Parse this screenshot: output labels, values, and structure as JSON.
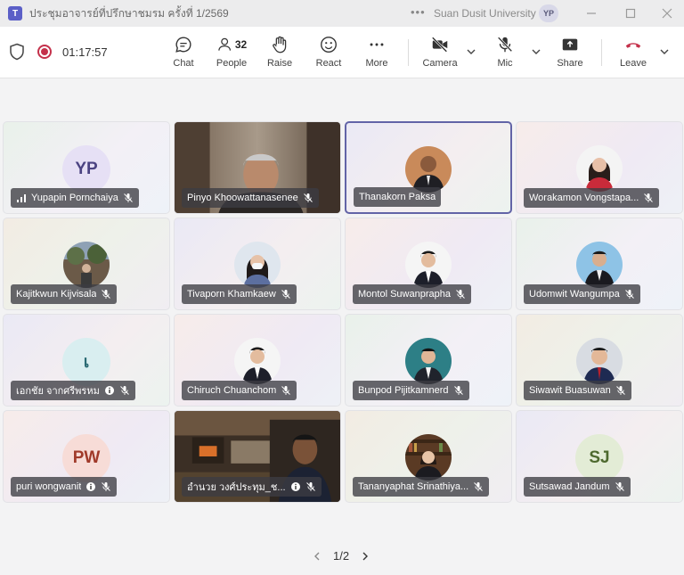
{
  "window": {
    "title": "ประชุมอาจารย์ที่ปรึกษาชมรม ครั้งที่ 1/2569",
    "organization": "Suan Dusit University",
    "user_initials": "YP",
    "app_icon_letter": "T"
  },
  "toolbar": {
    "timer": "01:17:57",
    "chat_label": "Chat",
    "people_label": "People",
    "people_count": "32",
    "raise_label": "Raise",
    "react_label": "React",
    "more_label": "More",
    "camera_label": "Camera",
    "mic_label": "Mic",
    "share_label": "Share",
    "leave_label": "Leave"
  },
  "participants": [
    {
      "name": "Yupapin Pornchaiya",
      "initials": "YP",
      "kind": "initials",
      "avatar_color": "#e6e0f5",
      "text_color": "#4b4382",
      "muted": true,
      "signal": true
    },
    {
      "name": "Pinyo Khoowattanasenee",
      "kind": "video",
      "muted": true
    },
    {
      "name": "Thanakorn Paksa",
      "kind": "photo",
      "photo_style": "suit-warm",
      "active": true,
      "muted": false
    },
    {
      "name": "Worakamon Vongstapa...",
      "kind": "photo",
      "photo_style": "woman-white",
      "muted": true
    },
    {
      "name": "Kajitkwun Kijvisala",
      "kind": "photo",
      "photo_style": "outdoor",
      "muted": true
    },
    {
      "name": "Tivaporn Khamkaew",
      "kind": "photo",
      "photo_style": "woman-mask",
      "muted": true
    },
    {
      "name": "Montol Suwanprapha",
      "kind": "photo",
      "photo_style": "suit-white",
      "muted": true
    },
    {
      "name": "Udomwit Wangumpa",
      "kind": "photo",
      "photo_style": "suit-blue",
      "muted": true
    },
    {
      "name": "เอกชัย จากศรีพรหม",
      "initials": "เ",
      "kind": "initials",
      "avatar_color": "#d9eef0",
      "text_color": "#2a6a73",
      "muted": true,
      "extra_icon": true
    },
    {
      "name": "Chiruch Chuanchom",
      "kind": "photo",
      "photo_style": "suit-white",
      "muted": true
    },
    {
      "name": "Bunpod Pijitkamnerd",
      "kind": "photo",
      "photo_style": "suit-teal",
      "muted": true
    },
    {
      "name": "Siwawit Buasuwan",
      "kind": "photo",
      "photo_style": "suit-red",
      "muted": true
    },
    {
      "name": "puri wongwanit",
      "initials": "PW",
      "kind": "initials",
      "avatar_color": "#f7dcd7",
      "text_color": "#a03a2a",
      "muted": true,
      "extra_icon": true
    },
    {
      "name": "อำนวย วงศ์ประทุม_ช...",
      "kind": "video2",
      "muted": true,
      "extra_icon": true
    },
    {
      "name": "Tananyaphat Srinathiya...",
      "kind": "photo",
      "photo_style": "library",
      "muted": true
    },
    {
      "name": "Sutsawad Jandum",
      "initials": "SJ",
      "kind": "initials",
      "avatar_color": "#e3ecd6",
      "text_color": "#4e6a2f",
      "muted": true
    }
  ],
  "pagination": {
    "label": "1/2"
  }
}
